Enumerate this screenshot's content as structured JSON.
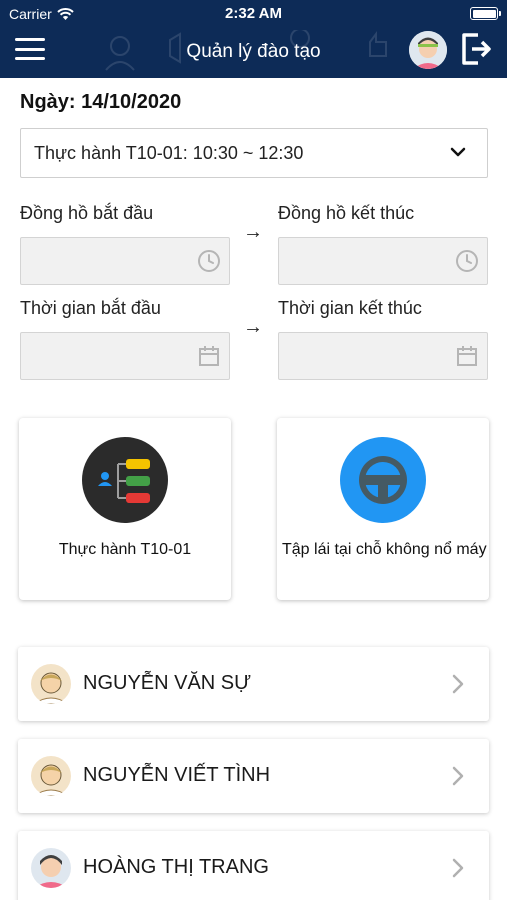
{
  "status_bar": {
    "carrier": "Carrier",
    "time": "2:32 AM"
  },
  "header": {
    "title": "Quản lý đào tạo"
  },
  "session": {
    "date_label": "Ngày: 14/10/2020",
    "selected_class": "Thực hành T10-01: 10:30 ~ 12:30"
  },
  "form": {
    "clock_start_label": "Đồng hồ bắt đầu",
    "clock_end_label": "Đồng hồ kết thúc",
    "time_start_label": "Thời gian bắt đầu",
    "time_end_label": "Thời gian kết thúc",
    "arrow": "→"
  },
  "cards": [
    {
      "label": "Thực hành T10-01",
      "icon": "mindmap-icon",
      "circle_color": "#2b2b2b"
    },
    {
      "label": "Tập lái tại chỗ không nổ máy",
      "icon": "steering-wheel-icon",
      "circle_color": "#2196f3"
    }
  ],
  "students": [
    {
      "name": "NGUYỄN VĂN SỰ"
    },
    {
      "name": "NGUYỄN VIẾT TÌNH"
    },
    {
      "name": "HOÀNG THỊ TRANG"
    }
  ],
  "colors": {
    "header_bg": "#0d2b57",
    "accent_blue": "#2196f3"
  }
}
